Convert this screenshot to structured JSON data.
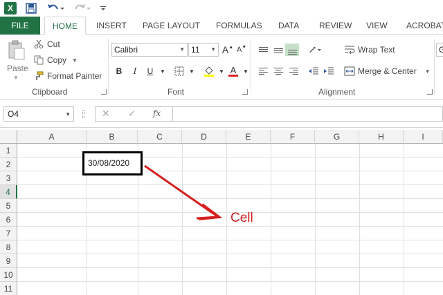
{
  "qat": {
    "app_icon": "excel-logo-icon",
    "app_letter": "X",
    "icons": [
      "save-icon",
      "undo-icon",
      "redo-icon",
      "customize-qat-icon"
    ]
  },
  "tabs": [
    "FILE",
    "HOME",
    "INSERT",
    "PAGE LAYOUT",
    "FORMULAS",
    "DATA",
    "REVIEW",
    "VIEW",
    "ACROBAT"
  ],
  "clipboard": {
    "paste_label": "Paste",
    "cut_label": "Cut",
    "copy_label": "Copy",
    "format_painter_label": "Format Painter",
    "group_label": "Clipboard"
  },
  "font": {
    "font_name": "Calibri",
    "font_size": "11",
    "bold": "B",
    "italic": "I",
    "underline": "U",
    "font_color_glyph": "A",
    "grow_glyph": "A",
    "shrink_glyph": "A",
    "group_label": "Font"
  },
  "alignment": {
    "wrap_text_label": "Wrap Text",
    "merge_label": "Merge & Center",
    "group_label": "Alignment"
  },
  "number_format_partial": "G",
  "formula_bar": {
    "name_box": "O4",
    "cancel_glyph": "✕",
    "enter_glyph": "✓",
    "fx_label": "fx",
    "formula": ""
  },
  "grid": {
    "columns": [
      "A",
      "B",
      "C",
      "D",
      "E",
      "F",
      "G",
      "H",
      "I"
    ],
    "rows": [
      "1",
      "2",
      "3",
      "4",
      "5",
      "6",
      "7",
      "8",
      "9",
      "10",
      "11"
    ],
    "active_row": "4",
    "cell_b2_value": "30/08/2020"
  },
  "annotation": {
    "label": "Cell",
    "color": "#d42020"
  },
  "colors": {
    "excel_green": "#217346",
    "arrow_red": "#d42020"
  }
}
